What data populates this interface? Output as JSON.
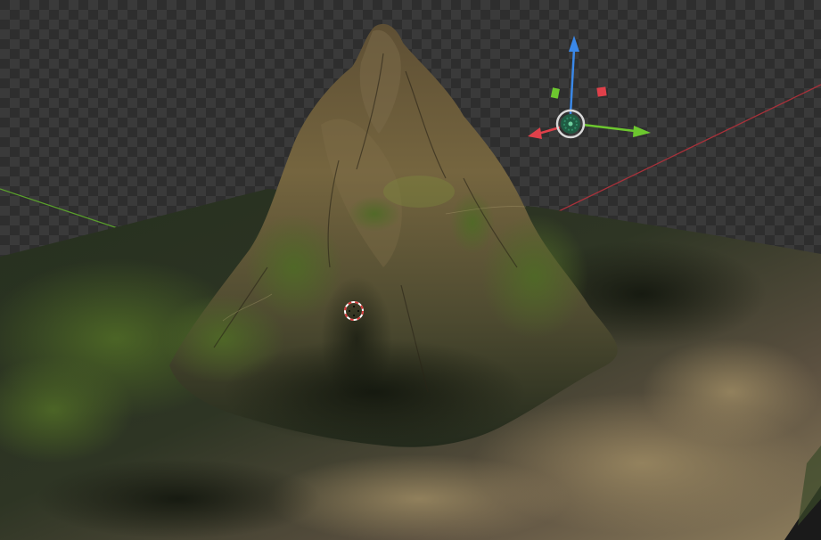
{
  "viewport": {
    "background": "transparent-checkerboard",
    "colors": {
      "axis_x": "#a8313a",
      "axis_y": "#5aa02c",
      "terrain_dark": "#2a3124",
      "terrain_moss": "#4b5e2a",
      "terrain_rock": "#6b5a3a",
      "terrain_sand": "#8a7a58"
    }
  },
  "gizmo": {
    "x_axis_color": "#e0404a",
    "y_axis_color": "#6dc72f",
    "z_axis_color": "#3a88e8",
    "center_icon": "transform-center-icon",
    "plane_handle_icons": [
      "plane-xz-handle-icon",
      "plane-yz-handle-icon"
    ]
  },
  "cursor_3d": {
    "icon": "3d-cursor-icon",
    "colors": [
      "#d63a3a",
      "#ffffff"
    ]
  }
}
